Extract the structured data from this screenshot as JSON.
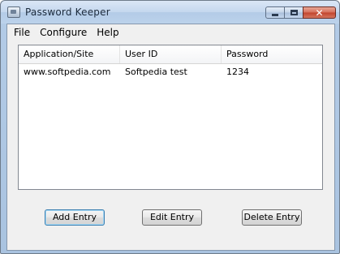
{
  "window": {
    "title": "Password Keeper",
    "icons": {
      "app": "app-icon",
      "minimize": "minimize-icon",
      "maximize": "maximize-icon",
      "close": "close-icon"
    }
  },
  "menu": {
    "items": [
      {
        "label": "File"
      },
      {
        "label": "Configure"
      },
      {
        "label": "Help"
      }
    ]
  },
  "list": {
    "columns": [
      "Application/Site",
      "User ID",
      "Password"
    ],
    "rows": [
      [
        "www.softpedia.com",
        "Softpedia test",
        "1234"
      ]
    ]
  },
  "buttons": {
    "add": "Add Entry",
    "edit": "Edit Entry",
    "delete": "Delete Entry"
  }
}
